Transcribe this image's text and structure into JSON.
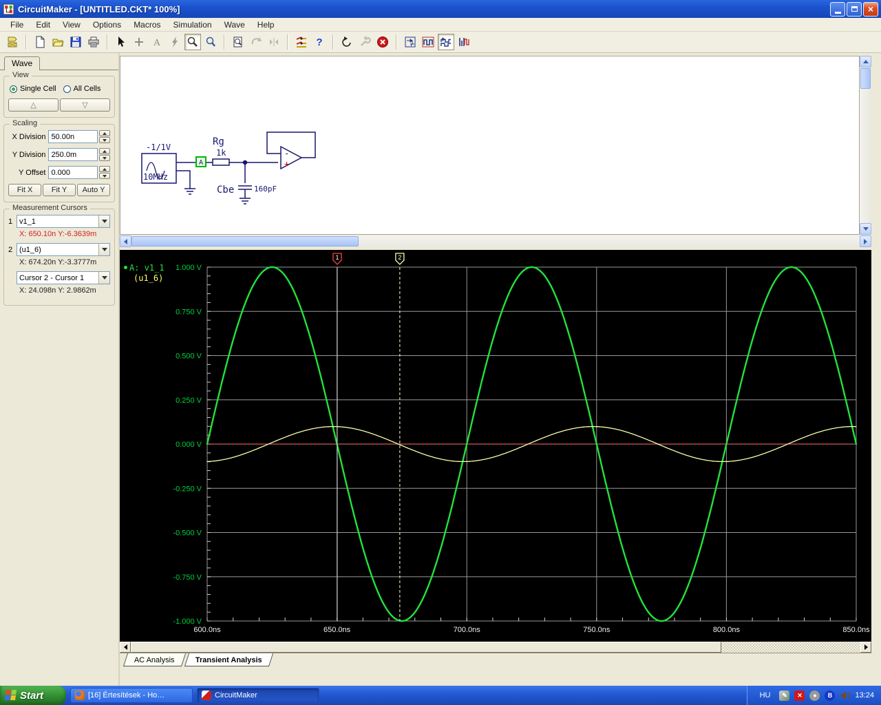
{
  "window_title": "CircuitMaker - [UNTITLED.CKT* 100%]",
  "menu_items": [
    "File",
    "Edit",
    "View",
    "Options",
    "Macros",
    "Simulation",
    "Wave",
    "Help"
  ],
  "toolbar_icons": [
    "parts-browser",
    "new-file",
    "open-file",
    "save-file",
    "print",
    "select-arrow",
    "wire-plus",
    "text-tool",
    "delete-lightning",
    "probe-tool",
    "zoom-tool",
    "zoom-preview",
    "rotate",
    "mirror",
    "simulation-switches",
    "help",
    "reset",
    "wrench",
    "stop-simulation",
    "scope-setup",
    "digital-waveform",
    "waveform-cursor",
    "mixed-signal"
  ],
  "panel": {
    "tab_label": "Wave",
    "view": {
      "legend": "View",
      "single_cell": "Single Cell",
      "all_cells": "All Cells",
      "up_glyph": "△",
      "down_glyph": "▽"
    },
    "scaling": {
      "legend": "Scaling",
      "x_division_label": "X Division",
      "x_division_value": "50.00n",
      "y_division_label": "Y Division",
      "y_division_value": "250.0m",
      "y_offset_label": "Y Offset",
      "y_offset_value": "0.000",
      "fit_x": "Fit X",
      "fit_y": "Fit Y",
      "auto_y": "Auto Y"
    },
    "cursors": {
      "legend": "Measurement Cursors",
      "row1": {
        "index": "1",
        "signal": "v1_1",
        "readout": "X: 650.10n  Y:-6.3639m"
      },
      "row2": {
        "index": "2",
        "signal": "(u1_6)",
        "readout": "X: 674.20n  Y:-3.3777m"
      },
      "diff": {
        "signal": "Cursor 2 - Cursor 1",
        "readout": "X: 24.098n  Y: 2.9862m"
      }
    }
  },
  "schematic": {
    "source_top": "-1/1V",
    "source_bottom": "10MHz",
    "node_label": "A",
    "r_name": "Rg",
    "r_value": "1k",
    "c_name": "Cbe",
    "c_value": "160pF",
    "opamp_minus": "-",
    "opamp_plus": "+"
  },
  "chart_data": {
    "type": "line",
    "x_unit": "ns",
    "x_range": [
      600,
      850
    ],
    "y_range": [
      -1,
      1
    ],
    "x_grid_step": 50,
    "y_grid_step": 0.25,
    "x_minor_tick": 10,
    "y_minor_tick": 0.05,
    "x_tick_labels": [
      "600.0ns",
      "650.0ns",
      "700.0ns",
      "750.0ns",
      "800.0ns",
      "850.0ns"
    ],
    "y_tick_labels": [
      "1.000 V",
      "0.750 V",
      "0.500 V",
      "0.250 V",
      "0.000 V",
      "-0.250 V",
      "-0.500 V",
      "-0.750 V",
      "-1.000 V"
    ],
    "grid_color": "#989898",
    "background": "#000000",
    "series": [
      {
        "name": "v1_1",
        "waveform": "sine",
        "amplitude_v": 1.0,
        "period_ns": 100,
        "phase_deg": 0,
        "offset_v": 0,
        "color": "#22e23c",
        "width": 2.4
      },
      {
        "name": "(u1_6)",
        "waveform": "sine",
        "amplitude_v": 0.099,
        "period_ns": 100,
        "phase_deg": -85,
        "offset_v": 0,
        "color": "#ffffa8",
        "width": 1.3
      }
    ],
    "reference_line": {
      "y": 0,
      "color": "#dd1414",
      "style": "dotted"
    },
    "cursors": [
      {
        "id": "1",
        "x_ns": 650.1,
        "flag_color": "#ff4040",
        "line_color": "#c8c8c8",
        "line_style": "solid"
      },
      {
        "id": "2",
        "x_ns": 674.2,
        "flag_color": "#ffff9c",
        "line_color": "#ffffcc",
        "line_style": "dashed"
      }
    ],
    "legend": [
      {
        "text": "A: v1_1",
        "color": "#1fe23c",
        "bullet": true
      },
      {
        "text": "(u1_6)",
        "color": "#ffff66",
        "bullet": false
      }
    ]
  },
  "analysis_tabs": [
    {
      "label": "AC Analysis",
      "active": false
    },
    {
      "label": "Transient Analysis",
      "active": true
    }
  ],
  "taskbar": {
    "start_label": "Start",
    "tasks": [
      {
        "label": "[16] Értesítések - Ho…",
        "icon": "firefox-icon",
        "active": false
      },
      {
        "label": "CircuitMaker",
        "icon": "circuitmaker-icon",
        "active": true
      }
    ],
    "language_indicator": "HU",
    "tray_icons": [
      "graphics-tablet-icon",
      "security-shield-icon",
      "audio-device-icon",
      "bluetooth-icon",
      "volume-icon"
    ],
    "clock": "13:24"
  }
}
